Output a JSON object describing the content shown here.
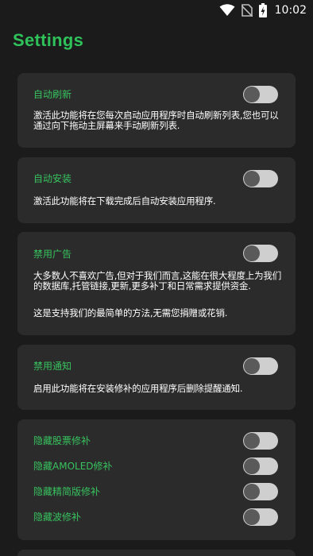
{
  "status_bar": {
    "time": "10:02",
    "icons": [
      "wifi-icon",
      "no-sim-icon",
      "battery-charging-icon"
    ]
  },
  "header": {
    "title": "Settings"
  },
  "settings": {
    "auto_refresh": {
      "label": "自动刷新",
      "description": "激活此功能将在您每次启动应用程序时自动刷新列表,您也可以通过向下拖动主屏幕来手动刷新列表.",
      "enabled": false
    },
    "auto_install": {
      "label": "自动安装",
      "description": "激活此功能将在下载完成后自动安装应用程序.",
      "enabled": false
    },
    "disable_ads": {
      "label": "禁用广告",
      "description": "大多数人不喜欢广告,但对于我们而言,这能在很大程度上为我们的数据库,托管链接,更新,更多补丁和日常需求提供资金.",
      "note": "这是支持我们的最简单的方法,无需您捐赠或花销.",
      "enabled": false
    },
    "disable_notifications": {
      "label": "禁用通知",
      "description": "启用此功能将在安装修补的应用程序后删除提醒通知.",
      "enabled": false
    },
    "hide_patches": [
      {
        "label": "隐藏股票修补",
        "enabled": false
      },
      {
        "label": "隐藏AMOLED修补",
        "enabled": false
      },
      {
        "label": "隐藏精简版修补",
        "enabled": false
      },
      {
        "label": "隐藏波修补",
        "enabled": false
      }
    ]
  },
  "colors": {
    "background": "#1b1b1b",
    "card": "#2b2b2b",
    "accent": "#2fc25a",
    "text": "#ffffff",
    "toggle_track": "#cfcfcf",
    "toggle_knob": "#5a5a5a"
  }
}
